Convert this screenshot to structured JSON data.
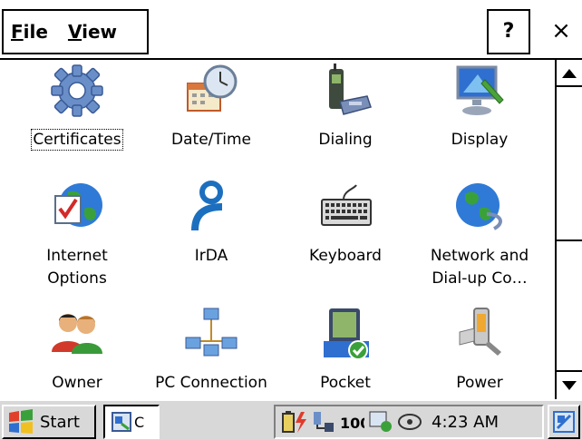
{
  "menu": {
    "file": "File",
    "file_rest": "ile",
    "view": "View",
    "view_rest": "iew",
    "help": "?",
    "close": "×"
  },
  "items": [
    {
      "label": "Certificates",
      "icon": "certificates-icon"
    },
    {
      "label": "Date/Time",
      "icon": "datetime-icon"
    },
    {
      "label": "Dialing",
      "icon": "dialing-icon"
    },
    {
      "label": "Display",
      "icon": "display-icon"
    },
    {
      "label": "Internet",
      "label2": "Options",
      "icon": "internet-options-icon"
    },
    {
      "label": "IrDA",
      "icon": "irda-icon"
    },
    {
      "label": "Keyboard",
      "icon": "keyboard-icon"
    },
    {
      "label": "Network and",
      "label2": "Dial-up Co…",
      "icon": "network-icon"
    },
    {
      "label": "Owner",
      "icon": "owner-icon"
    },
    {
      "label": "PC Connection",
      "icon": "pc-connection-icon"
    },
    {
      "label": "Pocket",
      "icon": "pocket-icon"
    },
    {
      "label": "Power",
      "icon": "power-icon"
    }
  ],
  "taskbar": {
    "start": "Start",
    "app_label": "C",
    "clock": "4:23 AM"
  },
  "colors": {
    "accent_blue": "#1e5fbf",
    "taskbar": "#d8d8d8"
  }
}
